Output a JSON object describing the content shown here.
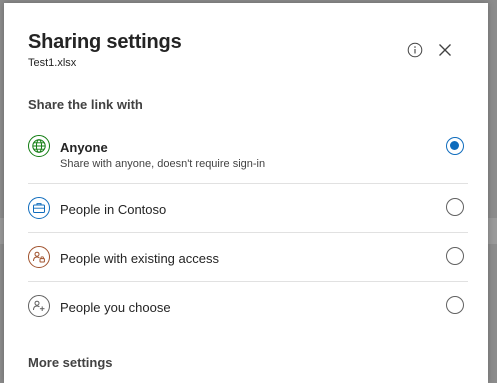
{
  "dialog": {
    "title": "Sharing settings",
    "filename": "Test1.xlsx",
    "info_icon": "info-icon",
    "close_icon": "close-icon"
  },
  "share_section": {
    "label": "Share the link with",
    "options": [
      {
        "label": "Anyone",
        "description": "Share with anyone, doesn't require sign-in",
        "icon": "globe-icon",
        "icon_color": "#107c10",
        "selected": true
      },
      {
        "label": "People in Contoso",
        "icon": "briefcase-icon",
        "icon_color": "#0f6cbd",
        "selected": false
      },
      {
        "label": "People with existing access",
        "icon": "people-lock-icon",
        "icon_color": "#a0522d",
        "selected": false
      },
      {
        "label": "People you choose",
        "icon": "people-add-icon",
        "icon_color": "#616161",
        "selected": false
      }
    ]
  },
  "more_settings": {
    "label": "More settings"
  },
  "colors": {
    "accent": "#0f6cbd"
  }
}
